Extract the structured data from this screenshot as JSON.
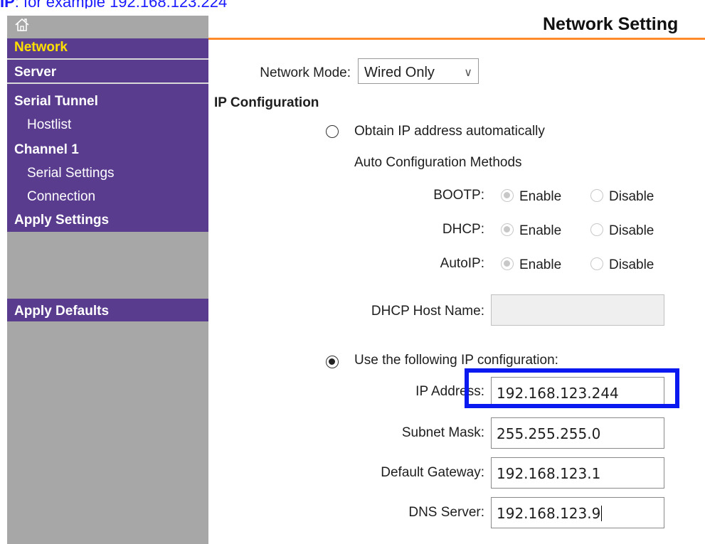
{
  "caption": {
    "prefix": "IP",
    "text": ": for example 192.168.123.224",
    "color": "#1a1aff"
  },
  "sidebar": {
    "home_icon": "home-icon",
    "items": [
      {
        "label": "Network",
        "active": true
      },
      {
        "label": "Server"
      },
      {
        "label": "Serial Tunnel"
      },
      {
        "label": "Hostlist"
      },
      {
        "label": "Channel 1"
      },
      {
        "label": "Serial Settings"
      },
      {
        "label": "Connection"
      },
      {
        "label": "Apply Settings"
      },
      {
        "label": "Apply Defaults"
      }
    ],
    "colors": {
      "menu_bg": "#5a3c8f",
      "panel_bg": "#a7a7a7",
      "active_text": "#ffe000"
    }
  },
  "header": {
    "title": "Network Setting",
    "rule_color": "#ff8a2a"
  },
  "form": {
    "network_mode": {
      "label": "Network Mode:",
      "value": "Wired Only"
    },
    "ip_config_heading": "IP Configuration",
    "obtain_auto_label": "Obtain IP address automatically",
    "auto_methods_label": "Auto Configuration Methods",
    "enable_label": "Enable",
    "disable_label": "Disable",
    "methods": [
      {
        "label": "BOOTP:",
        "value": "Enable"
      },
      {
        "label": "DHCP:",
        "value": "Enable"
      },
      {
        "label": "AutoIP:",
        "value": "Enable"
      }
    ],
    "dhcp_host_name": {
      "label": "DHCP Host Name:",
      "value": ""
    },
    "use_following_label": "Use the following IP configuration:",
    "ip_address": {
      "label": "IP Address:",
      "value": "192.168.123.244"
    },
    "subnet_mask": {
      "label": "Subnet Mask:",
      "value": "255.255.255.0"
    },
    "default_gateway": {
      "label": "Default Gateway:",
      "value": "192.168.123.1"
    },
    "dns_server": {
      "label": "DNS Server:",
      "value": "192.168.123.9"
    },
    "selected_mode": "Use the following IP configuration"
  },
  "highlight_color": "#0a19f0"
}
